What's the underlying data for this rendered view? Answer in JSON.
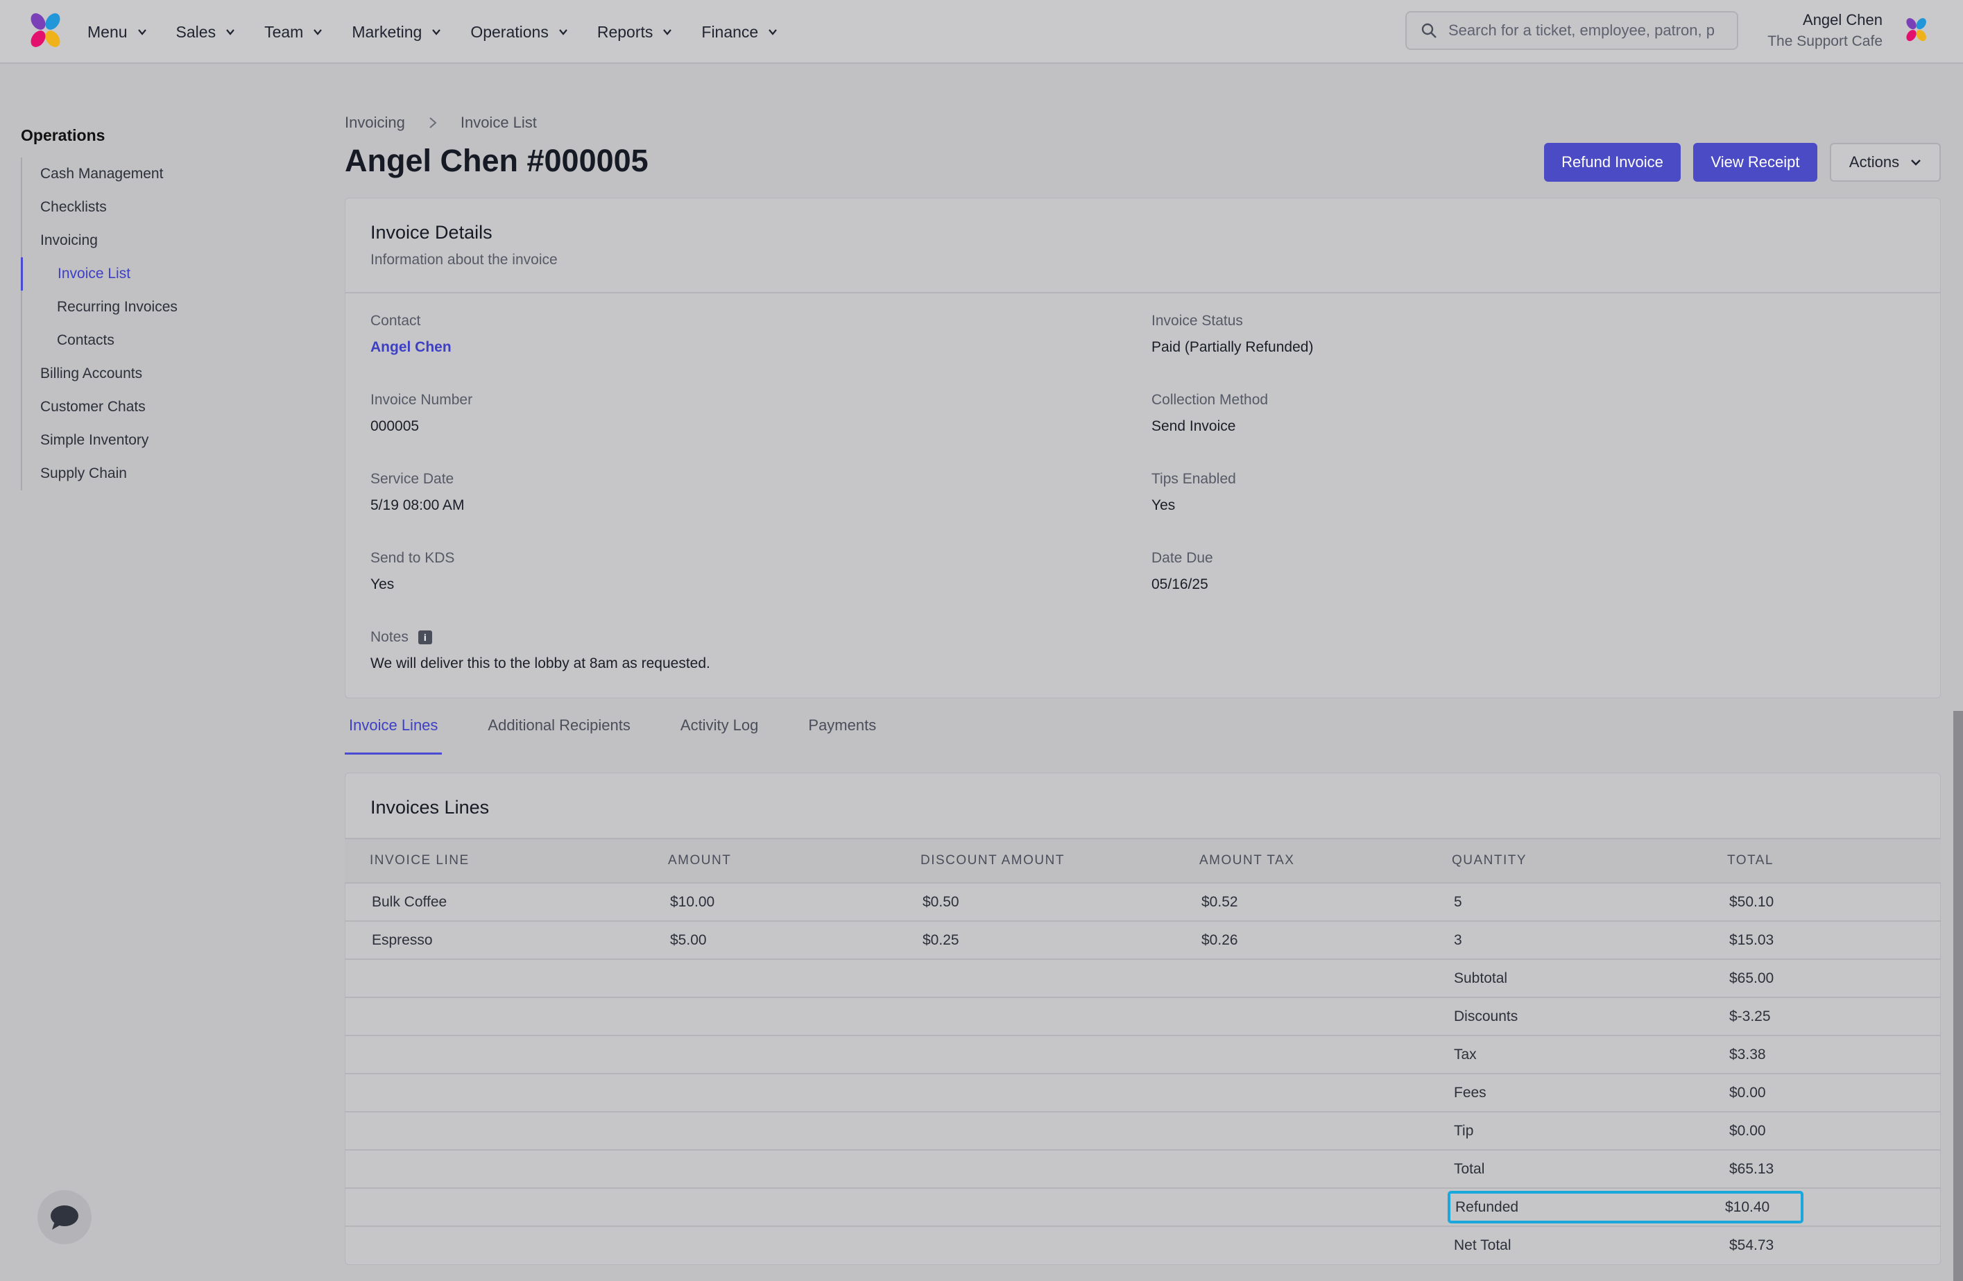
{
  "nav": {
    "items": [
      {
        "label": "Menu"
      },
      {
        "label": "Sales"
      },
      {
        "label": "Team"
      },
      {
        "label": "Marketing"
      },
      {
        "label": "Operations"
      },
      {
        "label": "Reports"
      },
      {
        "label": "Finance"
      }
    ],
    "search_placeholder": "Search for a ticket, employee, patron, p",
    "user_name": "Angel Chen",
    "user_org": "The Support Cafe"
  },
  "sidebar": {
    "heading": "Operations",
    "items": [
      {
        "label": "Cash Management"
      },
      {
        "label": "Checklists"
      },
      {
        "label": "Invoicing"
      },
      {
        "label": "Invoice List"
      },
      {
        "label": "Recurring Invoices"
      },
      {
        "label": "Contacts"
      },
      {
        "label": "Billing Accounts"
      },
      {
        "label": "Customer Chats"
      },
      {
        "label": "Simple Inventory"
      },
      {
        "label": "Supply Chain"
      }
    ],
    "active": "Invoice List"
  },
  "breadcrumb": [
    "Invoicing",
    "Invoice List"
  ],
  "page_title": "Angel Chen #000005",
  "actions": {
    "refund": "Refund Invoice",
    "receipt": "View Receipt",
    "more": "Actions"
  },
  "details": {
    "title": "Invoice Details",
    "subtitle": "Information about the invoice",
    "contact_label": "Contact",
    "contact_value": "Angel Chen",
    "status_label": "Invoice Status",
    "status_value": "Paid (Partially Refunded)",
    "number_label": "Invoice Number",
    "number_value": "000005",
    "collection_label": "Collection Method",
    "collection_value": "Send Invoice",
    "service_label": "Service Date",
    "service_value": "5/19 08:00 AM",
    "tips_label": "Tips Enabled",
    "tips_value": "Yes",
    "kds_label": "Send to KDS",
    "kds_value": "Yes",
    "due_label": "Date Due",
    "due_value": "05/16/25",
    "notes_label": "Notes",
    "notes_value": "We will deliver this to the lobby at 8am as requested."
  },
  "tabs": [
    {
      "label": "Invoice Lines"
    },
    {
      "label": "Additional Recipients"
    },
    {
      "label": "Activity Log"
    },
    {
      "label": "Payments"
    }
  ],
  "lines": {
    "title": "Invoices Lines",
    "columns": [
      "INVOICE LINE",
      "AMOUNT",
      "DISCOUNT AMOUNT",
      "AMOUNT TAX",
      "QUANTITY",
      "TOTAL"
    ],
    "rows": [
      [
        "Bulk Coffee",
        "$10.00",
        "$0.50",
        "$0.52",
        "5",
        "$50.10"
      ],
      [
        "Espresso",
        "$5.00",
        "$0.25",
        "$0.26",
        "3",
        "$15.03"
      ]
    ],
    "summary": [
      {
        "label": "Subtotal",
        "value": "$65.00"
      },
      {
        "label": "Discounts",
        "value": "$-3.25"
      },
      {
        "label": "Tax",
        "value": "$3.38"
      },
      {
        "label": "Fees",
        "value": "$0.00"
      },
      {
        "label": "Tip",
        "value": "$0.00"
      },
      {
        "label": "Total",
        "value": "$65.13"
      },
      {
        "label": "Refunded",
        "value": "$10.40"
      },
      {
        "label": "Net Total",
        "value": "$54.73"
      }
    ]
  },
  "colors": {
    "accent": "#4b4bc6",
    "highlight": "#1aa7dc"
  },
  "icons": [
    "app-logo-icon",
    "chevron-down-icon",
    "search-icon",
    "chevron-right-icon",
    "info-icon",
    "chat-icon"
  ]
}
